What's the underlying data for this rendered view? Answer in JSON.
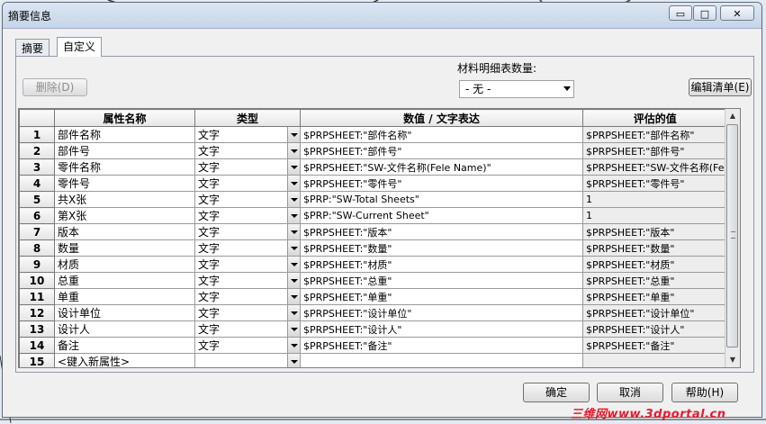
{
  "window": {
    "title": "摘要信息",
    "min_label": "▭",
    "max_label": "□",
    "close_label": "✕"
  },
  "tabs": [
    {
      "label": "摘要"
    },
    {
      "label": "自定义"
    }
  ],
  "toolbar": {
    "delete_label": "删除(D)",
    "bom_qty_label": "材料明细表数量:",
    "bom_qty_value": "- 无 -",
    "edit_list_label": "编辑清单(E)"
  },
  "grid": {
    "headers": [
      "",
      "属性名称",
      "类型",
      "数值 / 文字表达",
      "评估的值"
    ],
    "rows": [
      {
        "n": "1",
        "name": "部件名称",
        "type": "文字",
        "value": "$PRPSHEET:\"部件名称\"",
        "evaluated": "$PRPSHEET:\"部件名称\""
      },
      {
        "n": "2",
        "name": "部件号",
        "type": "文字",
        "value": "$PRPSHEET:\"部件号\"",
        "evaluated": "$PRPSHEET:\"部件号\""
      },
      {
        "n": "3",
        "name": "零件名称",
        "type": "文字",
        "value": "$PRPSHEET:\"SW-文件名称(Fele Name)\"",
        "evaluated": "$PRPSHEET:\"SW-文件名称(Fel"
      },
      {
        "n": "4",
        "name": "零件号",
        "type": "文字",
        "value": "$PRPSHEET:\"零件号\"",
        "evaluated": "$PRPSHEET:\"零件号\""
      },
      {
        "n": "5",
        "name": "共X张",
        "type": "文字",
        "value": "$PRP:\"SW-Total Sheets\"",
        "evaluated": "1"
      },
      {
        "n": "6",
        "name": "第X张",
        "type": "文字",
        "value": "$PRP:\"SW-Current Sheet\"",
        "evaluated": "1"
      },
      {
        "n": "7",
        "name": "版本",
        "type": "文字",
        "value": "$PRPSHEET:\"版本\"",
        "evaluated": "$PRPSHEET:\"版本\""
      },
      {
        "n": "8",
        "name": "数量",
        "type": "文字",
        "value": "$PRPSHEET:\"数量\"",
        "evaluated": "$PRPSHEET:\"数量\""
      },
      {
        "n": "9",
        "name": "材质",
        "type": "文字",
        "value": "$PRPSHEET:\"材质\"",
        "evaluated": "$PRPSHEET:\"材质\""
      },
      {
        "n": "10",
        "name": "总重",
        "type": "文字",
        "value": "$PRPSHEET:\"总重\"",
        "evaluated": "$PRPSHEET:\"总重\""
      },
      {
        "n": "11",
        "name": "单重",
        "type": "文字",
        "value": "$PRPSHEET:\"单重\"",
        "evaluated": "$PRPSHEET:\"单重\""
      },
      {
        "n": "12",
        "name": "设计单位",
        "type": "文字",
        "value": "$PRPSHEET:\"设计单位\"",
        "evaluated": "$PRPSHEET:\"设计单位\""
      },
      {
        "n": "13",
        "name": "设计人",
        "type": "文字",
        "value": "$PRPSHEET:\"设计人\"",
        "evaluated": "$PRPSHEET:\"设计人\""
      },
      {
        "n": "14",
        "name": "备注",
        "type": "文字",
        "value": "$PRPSHEET:\"备注\"",
        "evaluated": "$PRPSHEET:\"备注\""
      },
      {
        "n": "15",
        "name": "<键入新属性>",
        "type": "",
        "value": "",
        "evaluated": ""
      }
    ]
  },
  "footer": {
    "ok_label": "确定",
    "cancel_label": "取消",
    "help_label": "帮助(H)"
  },
  "watermark": "三维网www.3dportal.cn"
}
